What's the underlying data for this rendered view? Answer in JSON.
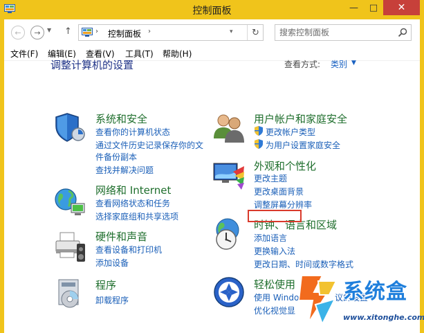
{
  "window": {
    "title": "控制面板",
    "min_glyph": "—",
    "max_glyph": "□",
    "close_glyph": "✕"
  },
  "navbar": {
    "back_glyph": "←",
    "forward_glyph": "→",
    "recent_glyph": "▼",
    "up_glyph": "↑",
    "address_sep": "›",
    "address_text": "控制面板",
    "address_dropdown_glyph": "▾",
    "refresh_glyph": "↻",
    "search_placeholder": "搜索控制面板"
  },
  "menubar": {
    "items": [
      "文件(F)",
      "编辑(E)",
      "查看(V)",
      "工具(T)",
      "帮助(H)"
    ]
  },
  "main": {
    "title": "调整计算机的设置",
    "view_label": "查看方式:",
    "view_value": "类别",
    "view_caret": "▼"
  },
  "categories": {
    "system_security": {
      "title": "系统和安全",
      "links": [
        "查看你的计算机状态",
        "通过文件历史记录保存你的文",
        "件备份副本",
        "查找并解决问题"
      ]
    },
    "network": {
      "title": "网络和 Internet",
      "links": [
        "查看网络状态和任务",
        "选择家庭组和共享选项"
      ]
    },
    "hardware": {
      "title": "硬件和声音",
      "links": [
        "查看设备和打印机",
        "添加设备"
      ]
    },
    "programs": {
      "title": "程序",
      "links": [
        "卸载程序"
      ]
    },
    "accounts": {
      "title": "用户帐户和家庭安全",
      "links": [
        "更改帐户类型",
        "为用户设置家庭安全"
      ]
    },
    "appearance": {
      "title": "外观和个性化",
      "links": [
        "更改主题",
        "更改桌面背景",
        "调整屏幕分辨率"
      ]
    },
    "clock": {
      "title": "时钟、语言和区域",
      "links": [
        "添加语言",
        "更换输入法",
        "更改日期、时间或数字格式"
      ]
    },
    "ease": {
      "title": "轻松使用",
      "links": [
        "使用 Windo",
        "议的设置",
        "优化视觉显"
      ]
    }
  },
  "watermark": {
    "name": "系统盒",
    "url": "www.xitonghe.com"
  },
  "colors": {
    "frame": "#f0c41b",
    "close": "#c7403a",
    "category_title": "#1e6e2c",
    "link": "#1a5fb8",
    "page_title": "#1e3287",
    "highlight": "#d93a2c"
  }
}
